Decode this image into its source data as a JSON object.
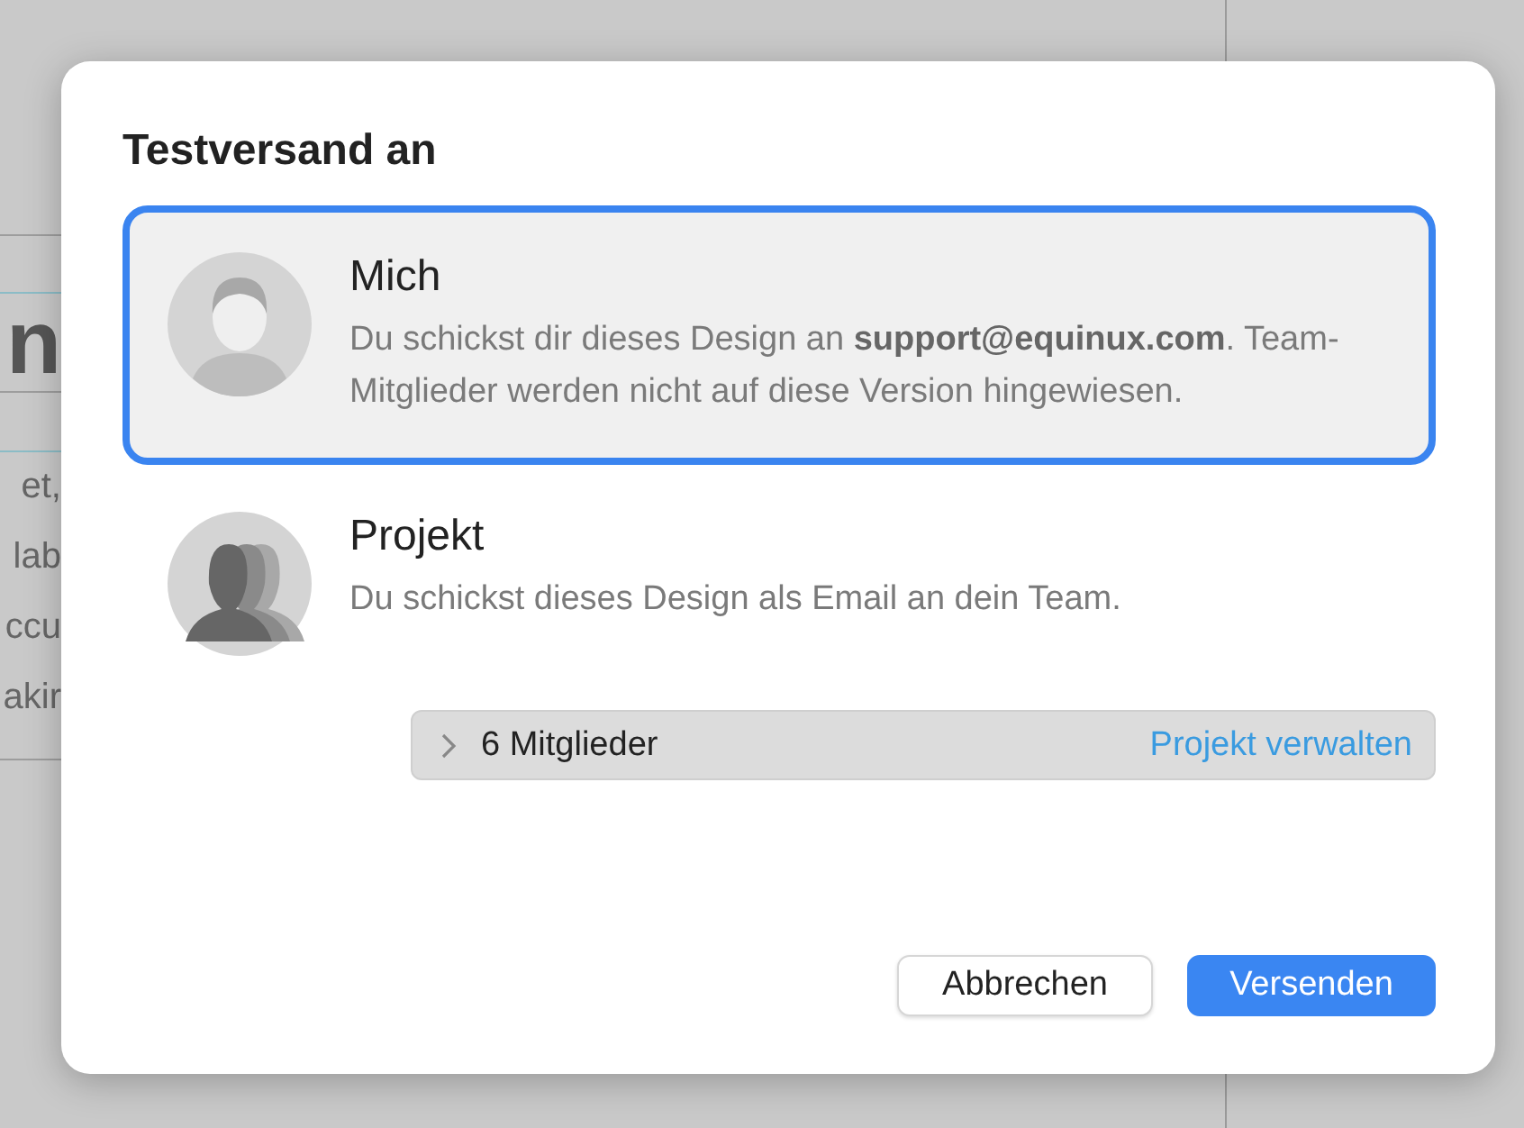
{
  "background": {
    "heading": "n",
    "lines": [
      "et,",
      "lab",
      "ccu",
      "akir"
    ]
  },
  "dialog": {
    "title": "Testversand an",
    "options": [
      {
        "kind": "person",
        "title": "Mich",
        "description": "Du schickst dir dieses Design an **support@equinux.com**. Team-Mitglieder werden nicht auf diese Version hingewiesen.",
        "selected": true
      },
      {
        "kind": "group",
        "title": "Projekt",
        "description": "Du schickst dieses Design als Email an dein Team.",
        "selected": false
      }
    ],
    "members": {
      "label": "6 Mitglieder",
      "expanded": false,
      "link": "Projekt verwalten"
    },
    "buttons": [
      {
        "label": "Abbrechen",
        "kind": "secondary"
      },
      {
        "label": "Versenden",
        "kind": "primary"
      }
    ]
  }
}
